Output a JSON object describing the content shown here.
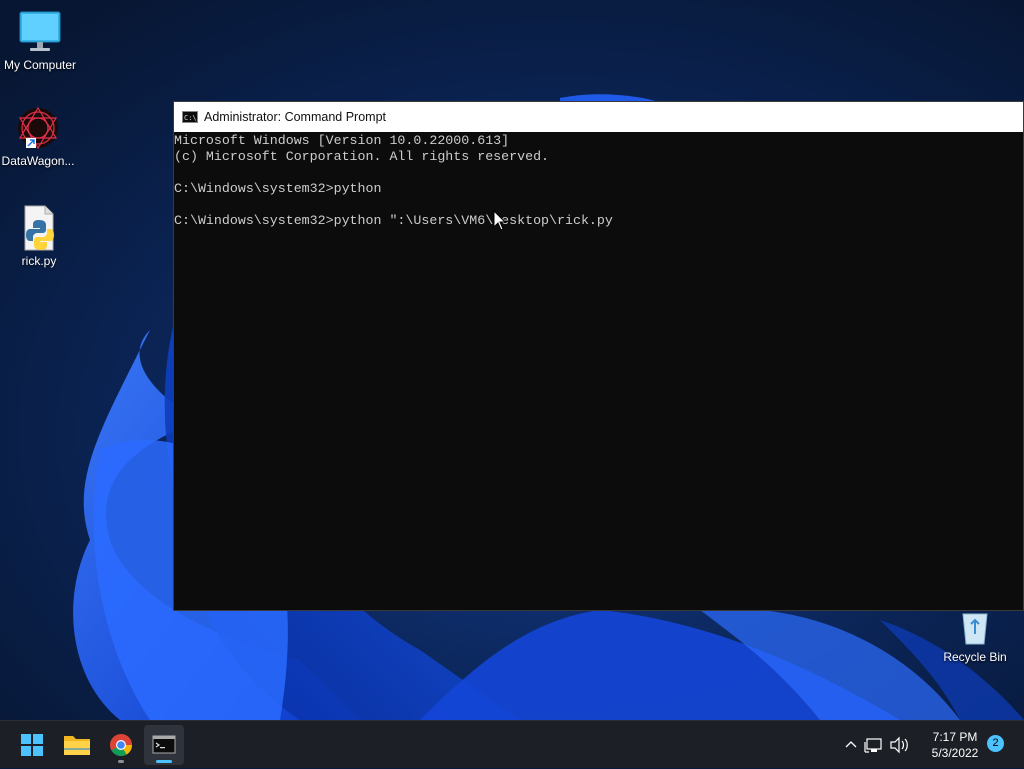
{
  "desktop": {
    "icons": [
      {
        "label": "My Computer",
        "icon": "monitor-icon"
      },
      {
        "label": "DataWagon...",
        "icon": "datawagon-app-icon"
      },
      {
        "label": "rick.py",
        "icon": "python-file-icon"
      },
      {
        "label": "Recycle Bin",
        "icon": "recycle-bin-icon"
      }
    ]
  },
  "cmd_window": {
    "title": "Administrator: Command Prompt",
    "icon_text": "C:\\_",
    "lines": [
      "Microsoft Windows [Version 10.0.22000.613]",
      "(c) Microsoft Corporation. All rights reserved.",
      "",
      "C:\\Windows\\system32>python",
      "",
      "C:\\Windows\\system32>python \":\\Users\\VM6\\Desktop\\rick.py"
    ]
  },
  "taskbar": {
    "apps": [
      {
        "name": "start",
        "icon": "windows-start-icon"
      },
      {
        "name": "file-explorer",
        "icon": "folder-icon"
      },
      {
        "name": "chrome",
        "icon": "chrome-icon"
      },
      {
        "name": "command-prompt",
        "icon": "terminal-icon",
        "active": true
      }
    ],
    "tray": {
      "time": "7:17 PM",
      "date": "5/3/2022",
      "notification_count": "2"
    }
  },
  "colors": {
    "accent": "#4cc2ff",
    "terminal_bg": "#0c0c0c",
    "terminal_fg": "#cccccc",
    "taskbar_bg": "#1c1f26"
  }
}
